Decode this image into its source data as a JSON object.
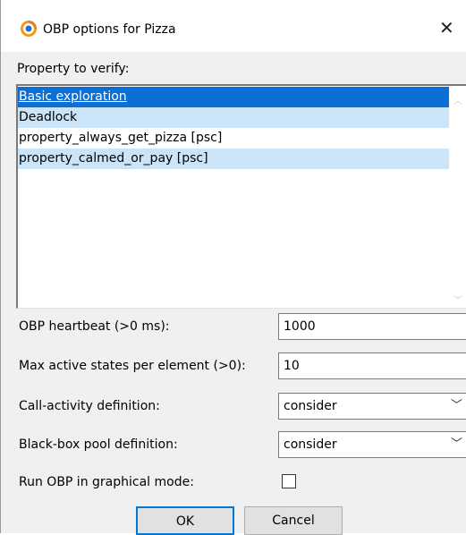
{
  "window": {
    "title": "OBP options for Pizza",
    "close_glyph": "✕"
  },
  "property_label": "Property to verify:",
  "properties": [
    {
      "label": "Basic exploration",
      "state": "selected"
    },
    {
      "label": "Deadlock",
      "state": "highlighted"
    },
    {
      "label": "property_always_get_pizza [psc]",
      "state": "normal"
    },
    {
      "label": "property_calmed_or_pay [psc]",
      "state": "highlighted"
    }
  ],
  "fields": {
    "heartbeat": {
      "label": "OBP heartbeat (>0 ms):",
      "value": "1000"
    },
    "max_states": {
      "label": "Max active states per element (>0):",
      "value": "10"
    },
    "call_activity": {
      "label": "Call-activity definition:",
      "value": "consider"
    },
    "black_box": {
      "label": "Black-box pool definition:",
      "value": "consider"
    },
    "graphical": {
      "label": "Run OBP in graphical mode:",
      "checked": false
    }
  },
  "buttons": {
    "ok": "OK",
    "cancel": "Cancel"
  },
  "icons": {
    "app": "obp-app-icon",
    "close": "close-icon",
    "dropdown": "chevron-down-icon"
  },
  "colors": {
    "selection": "#0b6fd6",
    "highlight": "#cce4f7",
    "default_button_border": "#0078d7"
  }
}
